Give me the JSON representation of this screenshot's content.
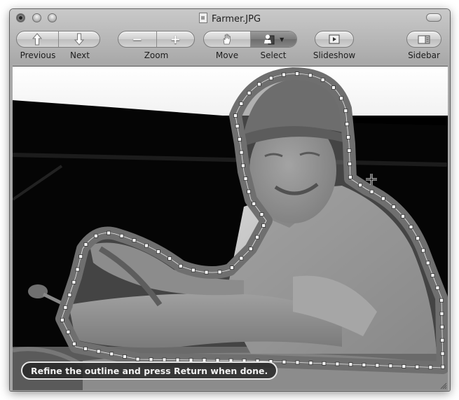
{
  "window": {
    "title": "Farmer.JPG",
    "title_icon": "document-image-icon"
  },
  "toolbar": {
    "previous_label": "Previous",
    "next_label": "Next",
    "zoom_label": "Zoom",
    "zoom_out_glyph": "−",
    "zoom_in_glyph": "+",
    "move_label": "Move",
    "select_label": "Select",
    "slideshow_label": "Slideshow",
    "sidebar_label": "Sidebar",
    "active_tool": "select"
  },
  "content": {
    "image_subject": "Farmer on tractor (grayscale photo) with lasso selection outline",
    "status_message": "Refine the outline and press Return when done."
  },
  "colors": {
    "toolbar_gray": "#a9a9a9",
    "selection_band": "#6f6f6f",
    "handle_fill": "#ffffff",
    "status_bg": "#2a2a2a"
  }
}
